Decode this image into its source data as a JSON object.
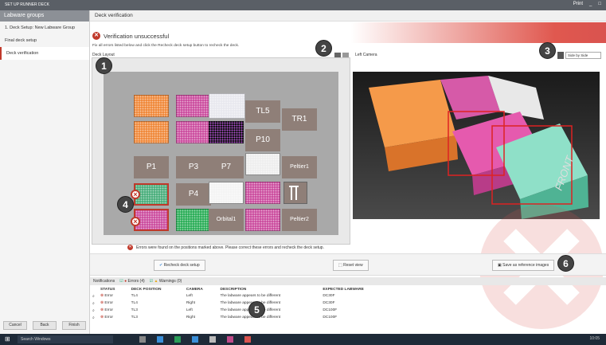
{
  "window": {
    "title": "SET UP RUNNER DECK",
    "right_controls": [
      "Print",
      "_",
      "□"
    ]
  },
  "left_panel": {
    "title": "Labware groups",
    "items": [
      {
        "label": "1. Deck Setup: New Labware Group"
      },
      {
        "label": "Final deck setup"
      },
      {
        "label": "Deck verification"
      }
    ],
    "buttons": {
      "cancel": "Cancel",
      "back": "Back",
      "finish": "Finish"
    }
  },
  "main": {
    "header": "Deck verification",
    "error_title": "Verification unsuccessful",
    "instruction": "Fix all errors listed below and click the Recheck deck setup button to recheck the deck.",
    "deck_label": "Deck Layout",
    "camera_label": "Left Camera",
    "view_select": "Side by Side",
    "front_label": "FRONT",
    "footer_message": "Errors were found on the positions marked above. Please correct these errors and recheck the deck setup."
  },
  "deck": {
    "positions": [
      "TL5",
      "TR1",
      "P10",
      "P1",
      "P3",
      "P7",
      "Peltier1",
      "P4",
      "Orbital1",
      "Peltier2"
    ]
  },
  "actions": {
    "recheck": "Recheck deck setup",
    "reset_view": "Reset view",
    "save_reference": "Save as reference images"
  },
  "notifications": {
    "label": "Notifications",
    "errors": "Errors (4)",
    "warnings": "Warnings (0)",
    "columns": [
      "STATUS",
      "DECK POSITION",
      "CAMERA",
      "DESCRIPTION",
      "EXPECTED LABWARE"
    ],
    "rows": [
      {
        "status": "Error",
        "position": "TL4",
        "camera": "Left",
        "description": "The labware appears to be different",
        "expected": "DC30F"
      },
      {
        "status": "Error",
        "position": "TL4",
        "camera": "Right",
        "description": "The labware appears to be different",
        "expected": "DC30F"
      },
      {
        "status": "Error",
        "position": "TL3",
        "camera": "Left",
        "description": "The labware appears to be different",
        "expected": "DC100F"
      },
      {
        "status": "Error",
        "position": "TL3",
        "camera": "Right",
        "description": "The labware appears to be different",
        "expected": "DC100F"
      }
    ]
  },
  "callouts": [
    "1",
    "2",
    "3",
    "4",
    "5",
    "6"
  ],
  "taskbar": {
    "search": "Search Windows",
    "time": "10:05"
  },
  "colors": {
    "error": "#c0392b",
    "titlebar": "#5a5f66",
    "deck": "#a9a9a9",
    "position": "#8f7f78"
  }
}
